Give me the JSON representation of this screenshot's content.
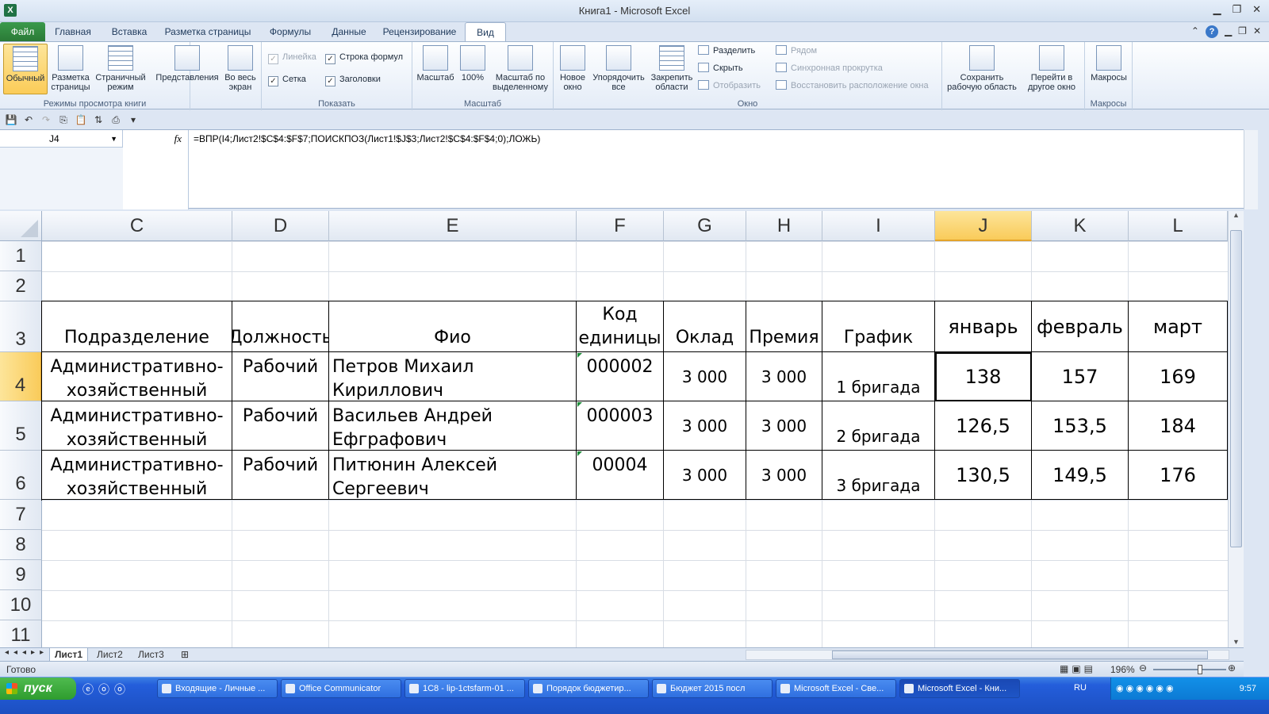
{
  "window": {
    "title": "Книга1  -  Microsoft Excel",
    "min": "▁",
    "max": "❐",
    "close": "✕"
  },
  "tabs": {
    "file": "Файл",
    "items": [
      "Главная",
      "Вставка",
      "Разметка страницы",
      "Формулы",
      "Данные",
      "Рецензирование",
      "Вид"
    ],
    "active": "Вид"
  },
  "ribbon": {
    "view_modes": {
      "normal": "Обычный",
      "page_layout": "Разметка страницы",
      "page_break": "Страничный режим",
      "custom_views": "Представления",
      "full_screen": "Во весь экран",
      "label": "Режимы просмотра книги"
    },
    "show": {
      "ruler": "Линейка",
      "formula_bar": "Строка формул",
      "gridlines": "Сетка",
      "headings": "Заголовки",
      "label": "Показать"
    },
    "zoom": {
      "zoom": "Масштаб",
      "hundred": "100%",
      "zoom_selection": "Масштаб по выделенному",
      "label": "Масштаб"
    },
    "window": {
      "new_window": "Новое окно",
      "arrange_all": "Упорядочить все",
      "freeze_panes": "Закрепить области",
      "split": "Разделить",
      "hide": "Скрыть",
      "unhide": "Отобразить",
      "side_by_side": "Рядом",
      "sync_scroll": "Синхронная прокрутка",
      "reset_position": "Восстановить расположение окна",
      "save_workspace": "Сохранить рабочую область",
      "switch_windows": "Перейти в другое окно",
      "label": "Окно"
    },
    "macros": {
      "macros": "Макросы",
      "label": "Макросы"
    }
  },
  "formula_bar": {
    "name_box": "J4",
    "fx": "fx",
    "formula": "=ВПР(I4;Лист2!$C$4:$F$7;ПОИСКПОЗ(Лист1!$J$3;Лист2!$C$4:$F$4;0);ЛОЖЬ)"
  },
  "columns": [
    "C",
    "D",
    "E",
    "F",
    "G",
    "H",
    "I",
    "J",
    "K",
    "L"
  ],
  "rows": [
    "1",
    "2",
    "3",
    "4",
    "5",
    "6",
    "7",
    "8",
    "9",
    "10",
    "11"
  ],
  "table": {
    "headers": [
      "Подразделение",
      "Должность",
      "Фио",
      "Код единицы",
      "Оклад",
      "Премия",
      "График",
      "январь",
      "февраль",
      "март"
    ],
    "rows": [
      [
        "Административно-хозяйственный отдел",
        "Рабочий",
        "Петров Михаил Кириллович",
        "000002",
        "3 000",
        "3 000",
        "1 бригада",
        "138",
        "157",
        "169"
      ],
      [
        "Административно-хозяйственный отдел",
        "Рабочий",
        "Васильев Андрей Ефграфович",
        "000003",
        "3 000",
        "3 000",
        "2 бригада",
        "126,5",
        "153,5",
        "184"
      ],
      [
        "Административно-хозяйственный отдел",
        "Рабочий",
        "Питюнин Алексей Сергеевич",
        "00004",
        "3 000",
        "3 000",
        "3 бригада",
        "130,5",
        "149,5",
        "176"
      ]
    ]
  },
  "sheet_tabs": [
    "Лист1",
    "Лист2",
    "Лист3"
  ],
  "status": {
    "ready": "Готово",
    "zoom": "196%"
  },
  "taskbar": {
    "start": "пуск",
    "buttons": [
      "Входящие - Личные ...",
      "Office Communicator",
      "1С8 - lip-1ctsfarm-01 ...",
      "Порядок бюджетир...",
      "Бюджет 2015 посл",
      "Microsoft Excel - Све...",
      "Microsoft Excel - Кни..."
    ],
    "lang": "RU",
    "time": "9:57"
  }
}
